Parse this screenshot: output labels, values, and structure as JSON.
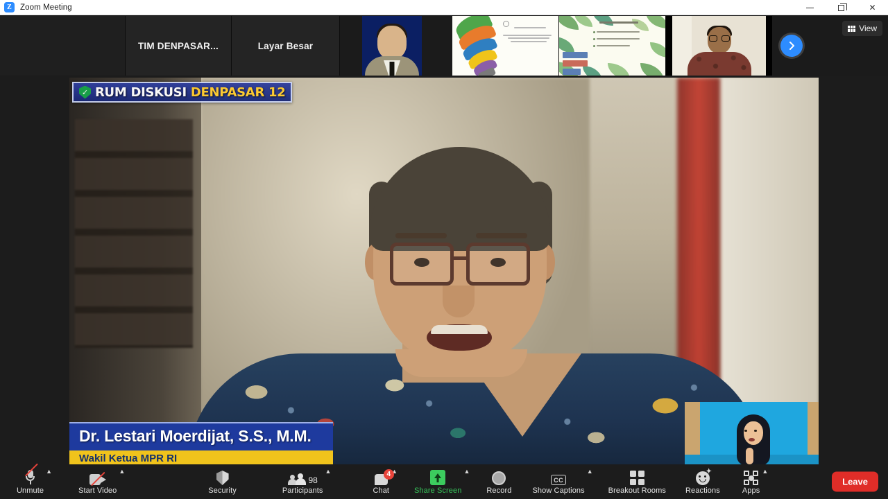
{
  "window": {
    "title": "Zoom Meeting",
    "logo_text": "Z",
    "minimize_label": "Minimize",
    "maximize_label": "Restore",
    "close_label": "Close"
  },
  "filmstrip": {
    "view_button": {
      "label": "View",
      "icon": "grid-icon"
    },
    "next_button": {
      "icon": "chevron-right-icon"
    },
    "thumbnails": [
      {
        "type": "name-only",
        "label": "TIM  DENPASAR..."
      },
      {
        "type": "name-only",
        "label": "Layar Besar"
      },
      {
        "type": "portrait",
        "label": ""
      },
      {
        "type": "slide-bulb",
        "label": ""
      },
      {
        "type": "slide-leaf",
        "label": ""
      },
      {
        "type": "video-person",
        "label": ""
      }
    ]
  },
  "stage": {
    "overlay_banner": {
      "shield_icon": "verified-shield-icon",
      "text_white": "RUM DISKUSI",
      "text_yellow": "DENPASAR 12"
    },
    "lower_third": {
      "name": "Dr. Lestari Moerdijat, S.S., M.M.",
      "title": "Wakil Ketua MPR RI"
    },
    "self_view": {
      "label": ""
    }
  },
  "toolbar": {
    "items": [
      {
        "id": "audio",
        "label": "Unmute",
        "icon": "microphone-muted-icon",
        "caret": true,
        "count": "",
        "badge": "",
        "accent": ""
      },
      {
        "id": "video",
        "label": "Start Video",
        "icon": "camera-off-icon",
        "caret": true,
        "count": "",
        "badge": "",
        "accent": ""
      },
      {
        "id": "security",
        "label": "Security",
        "icon": "shield-icon",
        "caret": false,
        "count": "",
        "badge": "",
        "accent": ""
      },
      {
        "id": "participants",
        "label": "Participants",
        "icon": "people-icon",
        "caret": true,
        "count": "98",
        "badge": "",
        "accent": ""
      },
      {
        "id": "chat",
        "label": "Chat",
        "icon": "chat-bubble-icon",
        "caret": true,
        "count": "",
        "badge": "4",
        "accent": ""
      },
      {
        "id": "share",
        "label": "Share Screen",
        "icon": "share-screen-icon",
        "caret": true,
        "count": "",
        "badge": "",
        "accent": "#37c75b"
      },
      {
        "id": "record",
        "label": "Record",
        "icon": "record-circle-icon",
        "caret": false,
        "count": "",
        "badge": "",
        "accent": ""
      },
      {
        "id": "captions",
        "label": "Show Captions",
        "icon": "closed-caption-icon",
        "caret": true,
        "count": "",
        "badge": "",
        "accent": ""
      },
      {
        "id": "breakout",
        "label": "Breakout Rooms",
        "icon": "breakout-rooms-icon",
        "caret": false,
        "count": "",
        "badge": "",
        "accent": ""
      },
      {
        "id": "reactions",
        "label": "Reactions",
        "icon": "reactions-smiley-icon",
        "caret": false,
        "count": "",
        "badge": "",
        "accent": ""
      },
      {
        "id": "apps",
        "label": "Apps",
        "icon": "apps-icon",
        "caret": true,
        "count": "",
        "badge": "",
        "accent": ""
      }
    ],
    "leave_label": "Leave",
    "cc_text": "CC"
  },
  "colors": {
    "accent_blue": "#2d8cff",
    "share_green": "#37c75b",
    "leave_red": "#e02d28",
    "badge_red": "#e8433a",
    "banner_blue": "#1e3a9e",
    "banner_yellow": "#f0c31c"
  }
}
